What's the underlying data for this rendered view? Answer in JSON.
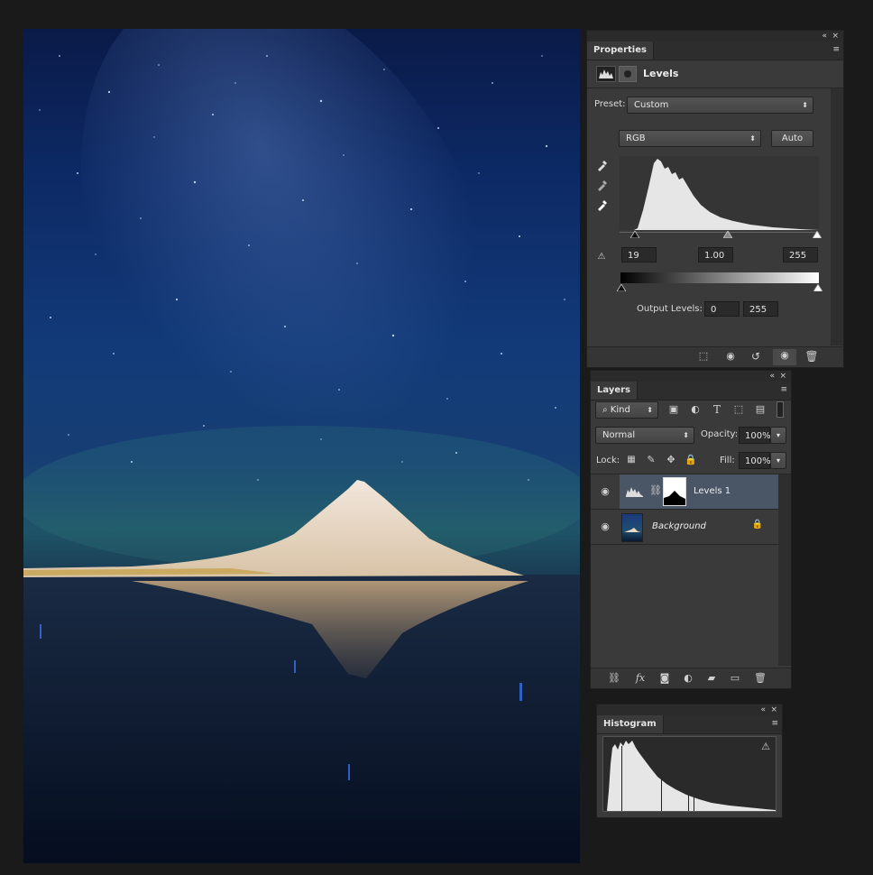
{
  "properties": {
    "tab": "Properties",
    "title": "Levels",
    "preset_label": "Preset:",
    "preset_value": "Custom",
    "channel": "RGB",
    "auto_label": "Auto",
    "input_black": "19",
    "input_gamma": "1.00",
    "input_white": "255",
    "output_label": "Output Levels:",
    "output_black": "0",
    "output_white": "255"
  },
  "layers": {
    "tab": "Layers",
    "filter_kind": "Kind",
    "blend_mode": "Normal",
    "opacity_label": "Opacity:",
    "opacity_value": "100%",
    "lock_label": "Lock:",
    "fill_label": "Fill:",
    "fill_value": "100%",
    "items": [
      {
        "name": "Levels 1",
        "selected": true
      },
      {
        "name": "Background",
        "locked": true
      }
    ],
    "fx_label": "fx"
  },
  "histogram_panel": {
    "tab": "Histogram"
  },
  "icons": {
    "collapse": "«",
    "close": "×",
    "menu": "≡",
    "text_tool": "T"
  },
  "colors": {
    "panel_bg": "#3a3a3a",
    "selected_layer": "#4a5566",
    "histogram_fill": "#e6e6e6"
  }
}
